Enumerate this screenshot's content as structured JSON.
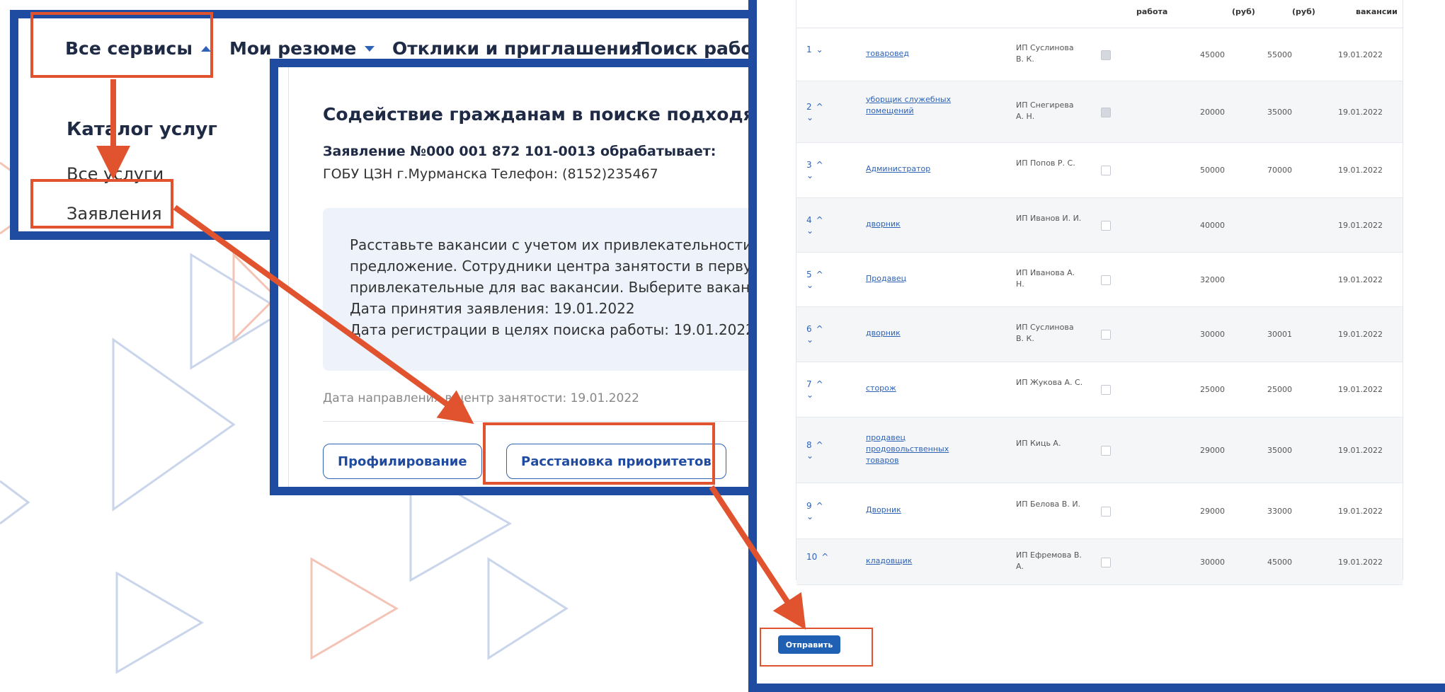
{
  "colors": {
    "frame": "#1f4ba0",
    "highlight": "#e0532e",
    "accent": "#2e62b5"
  },
  "nav": {
    "all_services": "Все сервисы",
    "my_resumes": "Мои резюме",
    "responses": "Отклики и приглашения",
    "job_search": "Поиск работы"
  },
  "catalog": {
    "title": "Каталог услуг",
    "all_services": "Все услуги",
    "applications": "Заявления"
  },
  "application": {
    "title": "Содействие гражданам в поиске подходящ",
    "processed_by": "Заявление №000 001 872 101-0013 обрабатывает:",
    "org": "ГОБУ ЦЗН г.Мурманска Телефон: (8152)235467",
    "info_lines": [
      "Расставьте вакансии с учетом их привлекательности д",
      "предложение. Сотрудники центра занятости в первую",
      "привлекательные для вас вакансии. Выберите вакансі",
      "Дата принятия заявления: 19.01.2022",
      "Дата регистрации в целях поиска работы: 19.01.2022."
    ],
    "sent_date": "Дата направления в центр занятости: 19.01.2022",
    "btn_profiling": "Профилирование",
    "btn_priorities": "Расстановка приоритетов"
  },
  "table": {
    "headers": [
      "работа",
      "(руб)",
      "(руб)",
      "вакансии"
    ],
    "rows": [
      {
        "n": "1",
        "up": "",
        "down": "⌄",
        "title": "товаровед",
        "employer": "ИП Суслинова В. К.",
        "checked": true,
        "min": "45000",
        "max": "55000",
        "date": "19.01.2022"
      },
      {
        "n": "2",
        "up": "^",
        "down": "⌄",
        "title": "уборщик служебных помещений",
        "employer": "ИП Снегирева А. Н.",
        "checked": true,
        "min": "20000",
        "max": "35000",
        "date": "19.01.2022"
      },
      {
        "n": "3",
        "up": "^",
        "down": "⌄",
        "title": "Администратор",
        "employer": "ИП Попов Р. С.",
        "checked": false,
        "min": "50000",
        "max": "70000",
        "date": "19.01.2022"
      },
      {
        "n": "4",
        "up": "^",
        "down": "⌄",
        "title": "дворник",
        "employer": "ИП Иванов И. И.",
        "checked": false,
        "min": "40000",
        "max": "",
        "date": "19.01.2022"
      },
      {
        "n": "5",
        "up": "^",
        "down": "⌄",
        "title": "Продавец",
        "employer": "ИП Иванова А. Н.",
        "checked": false,
        "min": "32000",
        "max": "",
        "date": "19.01.2022"
      },
      {
        "n": "6",
        "up": "^",
        "down": "⌄",
        "title": "дворник",
        "employer": "ИП Суслинова В. К.",
        "checked": false,
        "min": "30000",
        "max": "30001",
        "date": "19.01.2022"
      },
      {
        "n": "7",
        "up": "^",
        "down": "⌄",
        "title": "сторож",
        "employer": "ИП Жукова А. С.",
        "checked": false,
        "min": "25000",
        "max": "25000",
        "date": "19.01.2022"
      },
      {
        "n": "8",
        "up": "^",
        "down": "⌄",
        "title": "продавец продовольственных товаров",
        "employer": "ИП Киць А.",
        "checked": false,
        "min": "29000",
        "max": "35000",
        "date": "19.01.2022"
      },
      {
        "n": "9",
        "up": "^",
        "down": "⌄",
        "title": "Дворник",
        "employer": "ИП Белова В. И.",
        "checked": false,
        "min": "29000",
        "max": "33000",
        "date": "19.01.2022"
      },
      {
        "n": "10",
        "up": "^",
        "down": "",
        "title": "кладовщик",
        "employer": "ИП Ефремова В. А.",
        "checked": false,
        "min": "30000",
        "max": "45000",
        "date": "19.01.2022"
      }
    ]
  },
  "send_label": "Отправить"
}
